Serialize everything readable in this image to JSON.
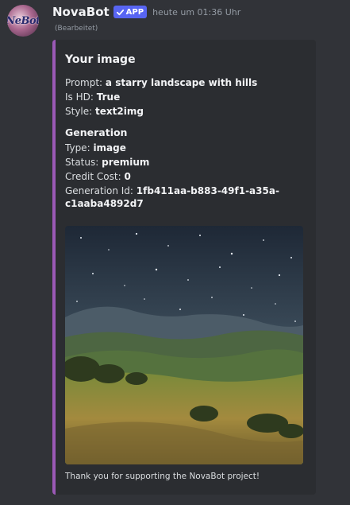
{
  "message": {
    "author": "NovaBot",
    "badge": "APP",
    "timestamp": "heute um 01:36 Uhr",
    "edited_label": "(Bearbeitet)",
    "avatar_text": "NeBot"
  },
  "embed": {
    "accent_color": "#9b59b6",
    "title": "Your image",
    "fields": {
      "prompt_label": "Prompt:",
      "prompt_value": "a starry landscape with hills",
      "hd_label": "Is HD:",
      "hd_value": "True",
      "style_label": "Style:",
      "style_value": "text2img"
    },
    "generation": {
      "title": "Generation",
      "type_label": "Type:",
      "type_value": "image",
      "status_label": "Status:",
      "status_value": "premium",
      "cost_label": "Credit Cost:",
      "cost_value": "0",
      "id_label": "Generation Id:",
      "id_value": "1fb411aa-b883-49f1-a35a-c1aaba4892d7"
    },
    "footer": "Thank you for supporting the NovaBot project!"
  },
  "colors": {
    "background": "#313338",
    "embed_background": "#2b2d31",
    "badge": "#5865f2"
  }
}
